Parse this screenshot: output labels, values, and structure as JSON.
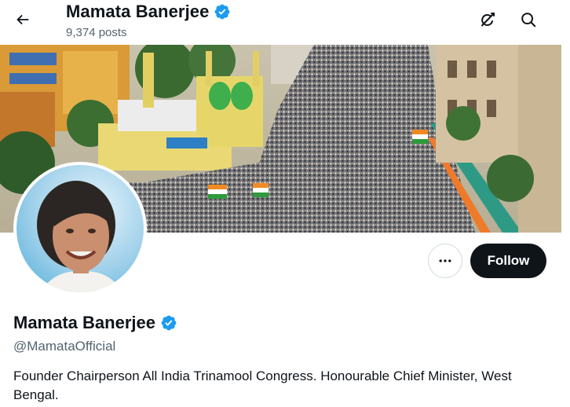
{
  "header": {
    "display_name": "Mamata Banerjee",
    "posts_count": "9,374 posts",
    "icons": [
      "back-arrow-icon",
      "verified-badge-icon",
      "grok-icon",
      "search-icon"
    ]
  },
  "profile": {
    "display_name": "Mamata Banerjee",
    "handle": "@MamataOfficial",
    "bio": "Founder Chairperson All India Trinamool Congress. Honourable Chief Minister, West Bengal.",
    "verified": true
  },
  "actions": {
    "follow_label": "Follow",
    "more_icon": "more-horizontal-icon"
  },
  "colors": {
    "verified_blue": "#1d9bf0",
    "follow_bg": "#0f1419",
    "secondary_text": "#536471"
  }
}
